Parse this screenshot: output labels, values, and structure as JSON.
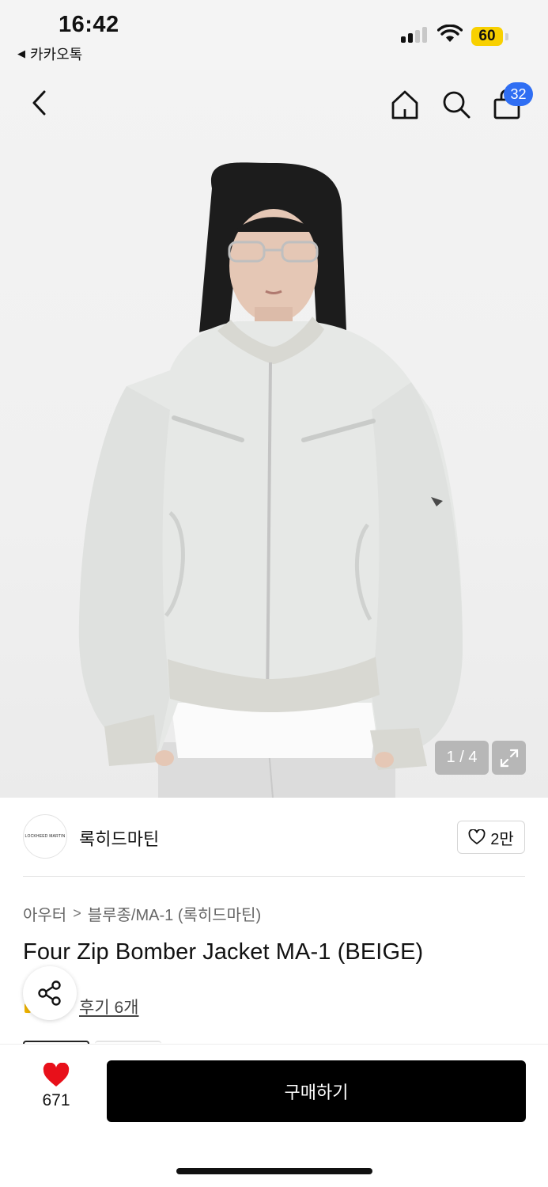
{
  "status_bar": {
    "time": "16:42",
    "back_app": "카카오톡",
    "battery": "60",
    "back_icon": "triangle-left-icon"
  },
  "nav": {
    "cart_count": "32",
    "icons": [
      "back-chevron-icon",
      "home-icon",
      "search-icon",
      "cart-icon"
    ]
  },
  "gallery": {
    "counter": "1 / 4",
    "current_index": 1,
    "total": 4
  },
  "brand": {
    "name": "록히드마틴",
    "logo_text": "LOCKHEED MARTIN",
    "likes": "2만"
  },
  "product": {
    "breadcrumb": [
      "아우터",
      "블루종/MA-1 (록히드마틴)"
    ],
    "breadcrumb_sep": ">",
    "title": "Four Zip Bomber Jacket MA-1 (BEIGE)",
    "review_link": "후기 6개"
  },
  "bottom_bar": {
    "wish_count": "671",
    "buy_label": "구매하기"
  },
  "colors": {
    "accent_blue": "#2f6ef3",
    "heart_red": "#e8101a",
    "battery_yellow": "#f8d000",
    "buy_button": "#000000"
  }
}
